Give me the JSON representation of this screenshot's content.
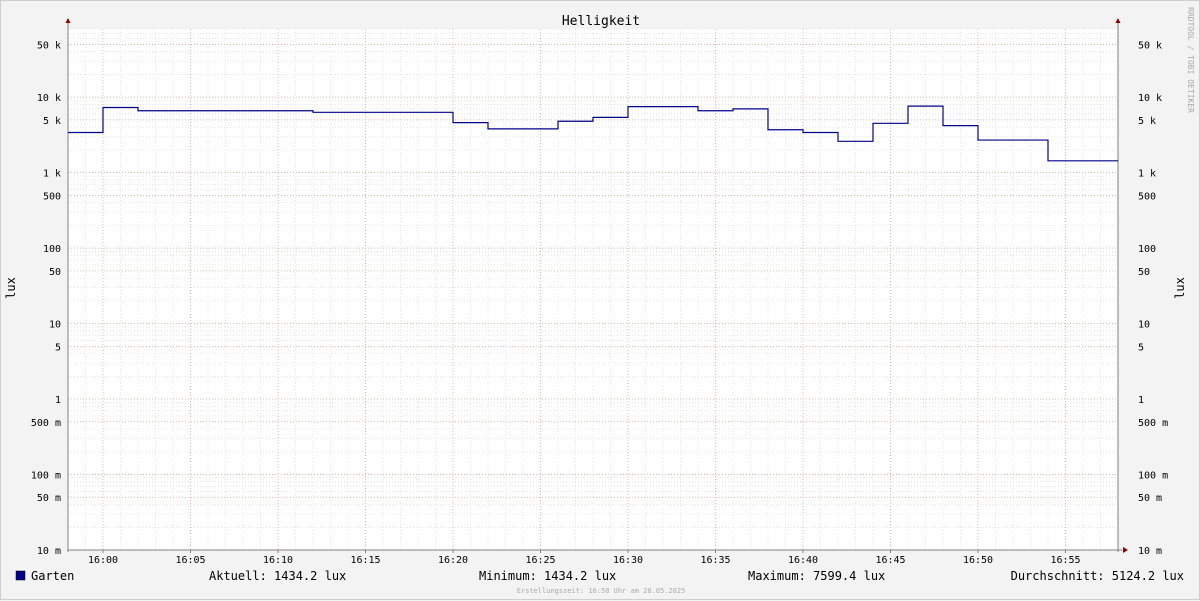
{
  "chart_data": {
    "type": "line",
    "title": "Helligkeit",
    "ylabel": "lux",
    "yscale": "log",
    "ylim": [
      0.01,
      80000
    ],
    "xlim_minutes": [
      "15:58",
      "16:58"
    ],
    "x_tick_labels": [
      "16:00",
      "16:05",
      "16:10",
      "16:15",
      "16:20",
      "16:25",
      "16:30",
      "16:35",
      "16:40",
      "16:45",
      "16:50",
      "16:55"
    ],
    "y_ticks": [
      {
        "value": 50000,
        "label": "50 k"
      },
      {
        "value": 10000,
        "label": "10 k"
      },
      {
        "value": 5000,
        "label": "5 k"
      },
      {
        "value": 1000,
        "label": "1 k"
      },
      {
        "value": 500,
        "label": "500"
      },
      {
        "value": 100,
        "label": "100"
      },
      {
        "value": 50,
        "label": "50"
      },
      {
        "value": 10,
        "label": "10"
      },
      {
        "value": 5,
        "label": "5"
      },
      {
        "value": 1,
        "label": "1"
      },
      {
        "value": 0.5,
        "label": "500 m"
      },
      {
        "value": 0.1,
        "label": "100 m"
      },
      {
        "value": 0.05,
        "label": "50 m"
      },
      {
        "value": 0.01,
        "label": "10 m"
      }
    ],
    "grid": true,
    "series": [
      {
        "name": "Garten",
        "color": "#00008b",
        "step": "post",
        "x": [
          "15:58",
          "16:00",
          "16:02",
          "16:04",
          "16:06",
          "16:08",
          "16:10",
          "16:12",
          "16:14",
          "16:16",
          "16:18",
          "16:20",
          "16:22",
          "16:24",
          "16:26",
          "16:28",
          "16:30",
          "16:32",
          "16:34",
          "16:36",
          "16:38",
          "16:40",
          "16:42",
          "16:44",
          "16:46",
          "16:48",
          "16:50",
          "16:52",
          "16:54",
          "16:58"
        ],
        "values": [
          3400,
          7300,
          6600,
          6600,
          6600,
          6600,
          6600,
          6300,
          6300,
          6300,
          6300,
          4600,
          3800,
          3800,
          4800,
          5400,
          7500,
          7500,
          6600,
          7000,
          3700,
          3400,
          2600,
          4500,
          7600,
          4200,
          2700,
          2700,
          1434.2,
          1434.2
        ]
      }
    ],
    "legend": "bottom-left"
  },
  "colors": {
    "background": "#f3f3f3",
    "plot_background": "#ffffff",
    "major_grid": "#e8a0a0",
    "minor_grid": "#d8d8d8",
    "axis": "#808080",
    "arrow": "#8b0000",
    "series": "#00008b"
  },
  "watermark": "RRDTOOL / TOBI OETIKER",
  "legend": {
    "series_label": "Garten",
    "current": "Aktuell: 1434.2 lux",
    "minimum": "Minimum: 1434.2 lux",
    "maximum": "Maximum: 7599.4 lux",
    "average": "Durchschnitt: 5124.2 lux"
  },
  "creation_time": "Erstellungszeit: 16:58 Uhr am 28.05.2025"
}
